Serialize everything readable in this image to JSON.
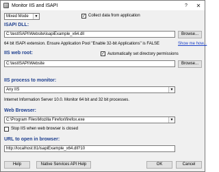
{
  "window": {
    "title": "Monitor IIS and ISAPI",
    "help_label": "?",
    "close_label": "✕"
  },
  "mode": {
    "selected": "Mixed Mode"
  },
  "collect_data": {
    "label": "Collect data from application",
    "checked": true
  },
  "isapi_dll": {
    "heading": "ISAPI DLL:",
    "path": "C:\\testISAPI\\Website\\isapiExample_x64.dll",
    "browse_label": "Browse...",
    "note": "64 bit ISAPI extension. Ensure Application Pool \"Enable 32-bit Applications\" is FALSE",
    "show_me_how": "Show me how..."
  },
  "web_root": {
    "heading": "IIS web root:",
    "auto_perms": {
      "label": "Automatically set directory permissions",
      "checked": true
    },
    "path": "C:\\testISAPI\\Website",
    "browse_label": "Browse..."
  },
  "iis_process": {
    "heading": "IIS process to monitor:",
    "selected": "Any IIS",
    "note": "Internet Information Server 10.0.  Monitor 64 bit and 32 bit processes."
  },
  "web_browser": {
    "heading": "Web Browser:",
    "selected": "C:\\Program Files\\Mozilla Firefox\\firefox.exe",
    "stop_iis": {
      "label": "Stop IIS when web browser is closed",
      "checked": false
    }
  },
  "url": {
    "heading": "URL to open in browser:",
    "value": "http://localhost:81/isapiExample_x64.dll?10"
  },
  "buttons": {
    "help": "Help",
    "native_help": "Native Services API Help",
    "ok": "OK",
    "cancel": "Cancel"
  }
}
